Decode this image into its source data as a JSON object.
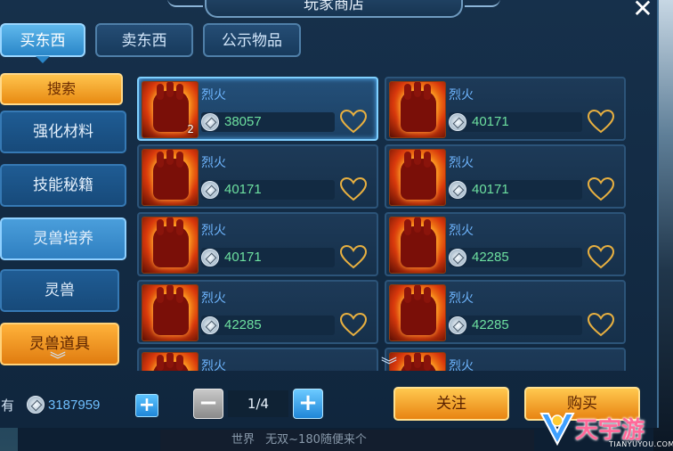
{
  "window": {
    "title": "玩家商店",
    "close_label": "✕"
  },
  "tabs": [
    {
      "label": "买东西",
      "active": true
    },
    {
      "label": "卖东西",
      "active": false
    },
    {
      "label": "公示物品",
      "active": false
    }
  ],
  "sidebar": {
    "search_label": "搜索",
    "categories": [
      {
        "label": "强化材料",
        "state": "normal"
      },
      {
        "label": "技能秘籍",
        "state": "normal"
      },
      {
        "label": "灵兽培养",
        "state": "selected"
      },
      {
        "label": "灵兽",
        "state": "normal"
      },
      {
        "label": "灵兽道具",
        "state": "orange"
      }
    ]
  },
  "items": [
    {
      "name": "烈火",
      "count": "2",
      "price": "38057",
      "selected": true
    },
    {
      "name": "烈火",
      "count": "",
      "price": "40171",
      "selected": false
    },
    {
      "name": "烈火",
      "count": "",
      "price": "40171",
      "selected": false
    },
    {
      "name": "烈火",
      "count": "",
      "price": "40171",
      "selected": false
    },
    {
      "name": "烈火",
      "count": "",
      "price": "40171",
      "selected": false
    },
    {
      "name": "烈火",
      "count": "",
      "price": "42285",
      "selected": false
    },
    {
      "name": "烈火",
      "count": "",
      "price": "42285",
      "selected": false
    },
    {
      "name": "烈火",
      "count": "",
      "price": "42285",
      "selected": false
    },
    {
      "name": "烈火",
      "count": "",
      "price": "",
      "selected": false
    },
    {
      "name": "烈火",
      "count": "",
      "price": "",
      "selected": false
    }
  ],
  "footer": {
    "owned_label": "拥有",
    "money": "3187959",
    "add_money_label": "+",
    "page_minus_label": "−",
    "page_plus_label": "+",
    "page": "1/4",
    "follow_label": "关注",
    "buy_label": "购买"
  },
  "chat": {
    "channel": "世界",
    "message": "无双~180随便来个"
  },
  "watermark": {
    "text": "天宇游",
    "sub": "TIANYUYOU.COM"
  },
  "colors": {
    "accent_blue": "#2a86c8",
    "accent_orange": "#e88a12",
    "price_green": "#6de0a0",
    "item_name_blue": "#6fb6ff",
    "heart_gold": "#e8b040"
  }
}
